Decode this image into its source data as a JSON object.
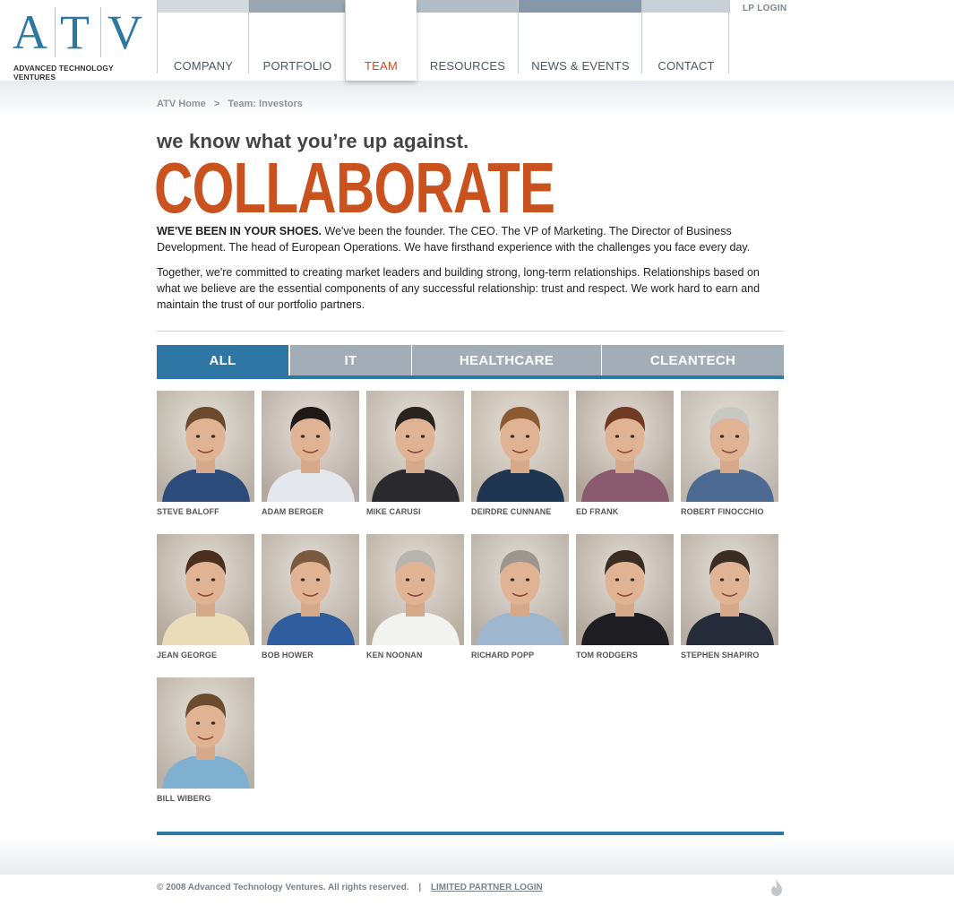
{
  "logo": {
    "letters": [
      "A",
      "T",
      "V"
    ],
    "subtitle": "ADVANCED TECHNOLOGY VENTURES"
  },
  "nav": [
    {
      "label": "COMPANY",
      "bar_color": "#d4d9de",
      "active": false
    },
    {
      "label": "PORTFOLIO",
      "bar_color": "#9aa6b2",
      "active": false
    },
    {
      "label": "TEAM",
      "bar_color": "#ffffff",
      "active": true
    },
    {
      "label": "RESOURCES",
      "bar_color": "#b3bdc7",
      "active": false
    },
    {
      "label": "NEWS & EVENTS",
      "bar_color": "#8597a8",
      "active": false
    },
    {
      "label": "CONTACT",
      "bar_color": "#c9cfd6",
      "active": false
    }
  ],
  "lp_login": "LP LOGIN",
  "breadcrumb": {
    "home": "ATV Home",
    "separator": ">",
    "current": "Team: Investors"
  },
  "tagline": "we know what you’re up against.",
  "hero": "COLLABORATE",
  "intro": {
    "lead": "WE'VE BEEN IN YOUR SHOES.",
    "text1": " We've been the founder. The CEO. The VP of Marketing. The Director of Business Development. The head of European Operations. We have firsthand experience with the challenges you face every day.",
    "text2": "Together, we're committed to creating market leaders and building strong, long-term relationships. Relationships based on what we believe are the essential components of any successful relationship: trust and respect. We work hard to earn and maintain the trust of our portfolio partners."
  },
  "tabs": [
    {
      "label": "ALL",
      "active": true,
      "color": "#2e77a4"
    },
    {
      "label": "IT",
      "active": false,
      "color": "#a3adb7"
    },
    {
      "label": "HEALTHCARE",
      "active": false,
      "color": "#a3adb7"
    },
    {
      "label": "CLEANTECH",
      "active": false,
      "color": "#a3adb7"
    }
  ],
  "team": [
    {
      "name": "STEVE BALOFF",
      "shirt": "#2c4a7a",
      "hair": "#6b4a2e",
      "bg": "#b8b0a4"
    },
    {
      "name": "ADAM BERGER",
      "shirt": "#e4e7ec",
      "hair": "#1f1a17",
      "bg": "#b4a9a2"
    },
    {
      "name": "MIKE CARUSI",
      "shirt": "#2a2a2e",
      "hair": "#2a2420",
      "bg": "#b9b0a6"
    },
    {
      "name": "DEIRDRE CUNNANE",
      "shirt": "#1f3552",
      "hair": "#8a5a33",
      "bg": "#bdb3a7"
    },
    {
      "name": "ED FRANK",
      "shirt": "#8a5a6e",
      "hair": "#6e3b22",
      "bg": "#b0a49a"
    },
    {
      "name": "ROBERT FINOCCHIO",
      "shirt": "#4c6a92",
      "hair": "#c8c8c4",
      "bg": "#bdb6ad"
    },
    {
      "name": "JEAN GEORGE",
      "shirt": "#e9dcb8",
      "hair": "#4a2e1e",
      "bg": "#b3a99d"
    },
    {
      "name": "BOB HOWER",
      "shirt": "#2f5d9e",
      "hair": "#7a5a3e",
      "bg": "#b7aea4"
    },
    {
      "name": "KEN NOONAN",
      "shirt": "#f2f2f0",
      "hair": "#b8b4ae",
      "bg": "#b8ada1"
    },
    {
      "name": "RICHARD POPP",
      "shirt": "#9fb6cf",
      "hair": "#9c968e",
      "bg": "#b5ada4"
    },
    {
      "name": "TOM RODGERS",
      "shirt": "#1e1e22",
      "hair": "#3a2c22",
      "bg": "#b1a79d"
    },
    {
      "name": "STEPHEN SHAPIRO",
      "shirt": "#262b3a",
      "hair": "#3b2d24",
      "bg": "#b6ada3"
    },
    {
      "name": "BILL WIBERG",
      "shirt": "#7fb0cf",
      "hair": "#6b4c2e",
      "bg": "#b9b0a5"
    }
  ],
  "footer": {
    "copyright": "© 2008 Advanced Technology Ventures. All rights reserved.",
    "separator": "|",
    "link": "LIMITED PARTNER LOGIN"
  }
}
